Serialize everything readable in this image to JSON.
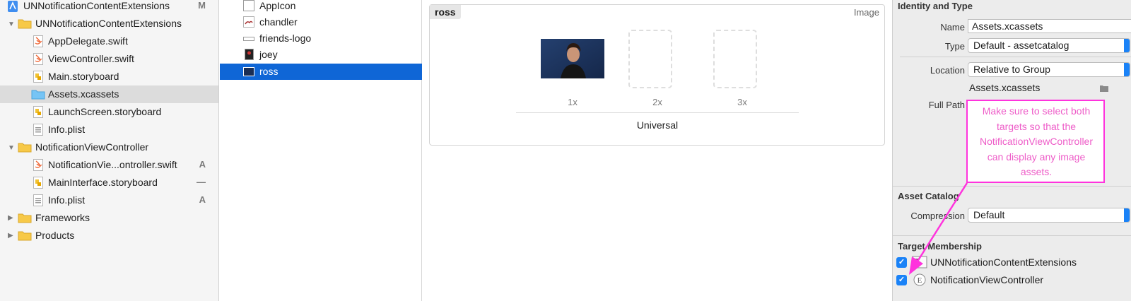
{
  "navigator": {
    "project": {
      "label": "UNNotificationContentExtensions",
      "badge": "M"
    },
    "items": [
      {
        "label": "UNNotificationContentExtensions",
        "kind": "folder",
        "expanded": true
      },
      {
        "label": "AppDelegate.swift",
        "kind": "swift"
      },
      {
        "label": "ViewController.swift",
        "kind": "swift"
      },
      {
        "label": "Main.storyboard",
        "kind": "storyboard"
      },
      {
        "label": "Assets.xcassets",
        "kind": "assets",
        "selected": true
      },
      {
        "label": "LaunchScreen.storyboard",
        "kind": "storyboard"
      },
      {
        "label": "Info.plist",
        "kind": "plist"
      },
      {
        "label": "NotificationViewController",
        "kind": "folder",
        "expanded": true
      },
      {
        "label": "NotificationVie...ontroller.swift",
        "kind": "swift",
        "badge": "A"
      },
      {
        "label": "MainInterface.storyboard",
        "kind": "storyboard",
        "badge": "—"
      },
      {
        "label": "Info.plist",
        "kind": "plist",
        "badge": "A"
      },
      {
        "label": "Frameworks",
        "kind": "folder",
        "expanded": false
      },
      {
        "label": "Products",
        "kind": "folder",
        "expanded": false
      }
    ]
  },
  "asset_list": {
    "items": [
      {
        "label": "AppIcon"
      },
      {
        "label": "chandler"
      },
      {
        "label": "friends-logo"
      },
      {
        "label": "joey"
      },
      {
        "label": "ross",
        "selected": true
      }
    ]
  },
  "editor": {
    "set_name": "ross",
    "set_type": "Image",
    "scales": [
      "1x",
      "2x",
      "3x"
    ],
    "universal_label": "Universal"
  },
  "inspector": {
    "identity_title": "Identity and Type",
    "name_label": "Name",
    "name_value": "Assets.xcassets",
    "type_label": "Type",
    "type_value": "Default - assetcatalog",
    "location_label": "Location",
    "location_value": "Relative to Group",
    "location_path": "Assets.xcassets",
    "full_path_label": "Full Path",
    "asset_catalog_title": "Asset Catalog",
    "compression_label": "Compression",
    "compression_value": "Default",
    "target_title": "Target Membership",
    "targets": [
      {
        "label": "UNNotificationContentExtensions",
        "checked": true
      },
      {
        "label": "NotificationViewController",
        "checked": true
      }
    ]
  },
  "annotation": {
    "text": "Make sure to select both targets so that the NotificationViewController can display any image assets.",
    "color": "#ff33dd"
  },
  "colors": {
    "selection_blue": "#0f66d6",
    "checkbox_blue": "#1a82f7",
    "folder_yellow": "#f7c948",
    "annotation_magenta": "#ff33dd"
  }
}
